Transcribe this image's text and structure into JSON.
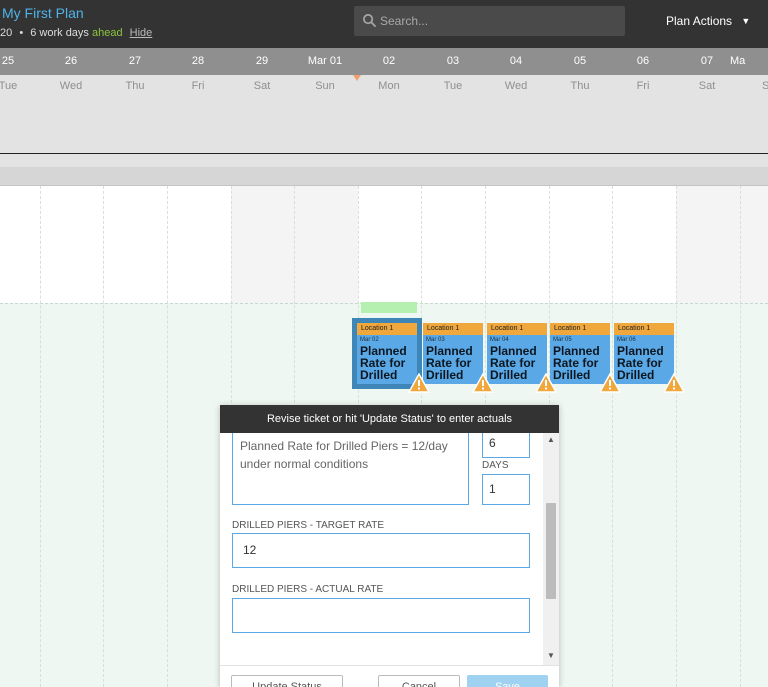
{
  "header": {
    "plan_title": "My First Plan",
    "date_fragment": "20",
    "separator": "•",
    "work_days": "6 work days",
    "ahead_label": "ahead",
    "hide_label": "Hide",
    "search_placeholder": "Search...",
    "plan_actions_label": "Plan Actions"
  },
  "timeline": {
    "dates": [
      "25",
      "26",
      "27",
      "28",
      "29",
      "Mar 01",
      "02",
      "03",
      "04",
      "05",
      "06",
      "07",
      "Ma"
    ],
    "days": [
      "Tue",
      "Wed",
      "Thu",
      "Fri",
      "Sat",
      "Sun",
      "Mon",
      "Tue",
      "Wed",
      "Thu",
      "Fri",
      "Sat",
      "S"
    ]
  },
  "tickets": [
    {
      "location": "Location 1",
      "date": "Mar 02",
      "name": "Planned Rate for Drilled",
      "selected": true
    },
    {
      "location": "Location 1",
      "date": "Mar 03",
      "name": "Planned Rate for Drilled",
      "selected": false
    },
    {
      "location": "Location 1",
      "date": "Mar 04",
      "name": "Planned Rate for Drilled",
      "selected": false
    },
    {
      "location": "Location 1",
      "date": "Mar 05",
      "name": "Planned Rate for Drilled",
      "selected": false
    },
    {
      "location": "Location 1",
      "date": "Mar 06",
      "name": "Planned Rate for Drilled",
      "selected": false
    }
  ],
  "modal": {
    "title": "Revise ticket or hit 'Update Status' to enter actuals",
    "description": "Planned Rate for Drilled Piers = 12/day under normal conditions",
    "top_value": "6",
    "days_label": "DAYS",
    "days_value": "1",
    "target_rate_label": "DRILLED PIERS - TARGET RATE",
    "target_rate_value": "12",
    "actual_rate_label": "DRILLED PIERS - ACTUAL RATE",
    "actual_rate_value": "",
    "update_status_button": "Update Status",
    "cancel_button": "Cancel",
    "save_button": "Save"
  },
  "colors": {
    "accent": "#5aa9e6",
    "ticket_header": "#f0a73c",
    "ahead_green": "#8cc63f",
    "title_blue": "#4fb3e8",
    "warning": "#f0a73c"
  },
  "icons": {
    "search": "search-icon",
    "chevron": "chevron-down-icon",
    "warning": "warning-icon",
    "scroll_up": "scroll-up-arrow-icon",
    "scroll_down": "scroll-down-arrow-icon"
  }
}
